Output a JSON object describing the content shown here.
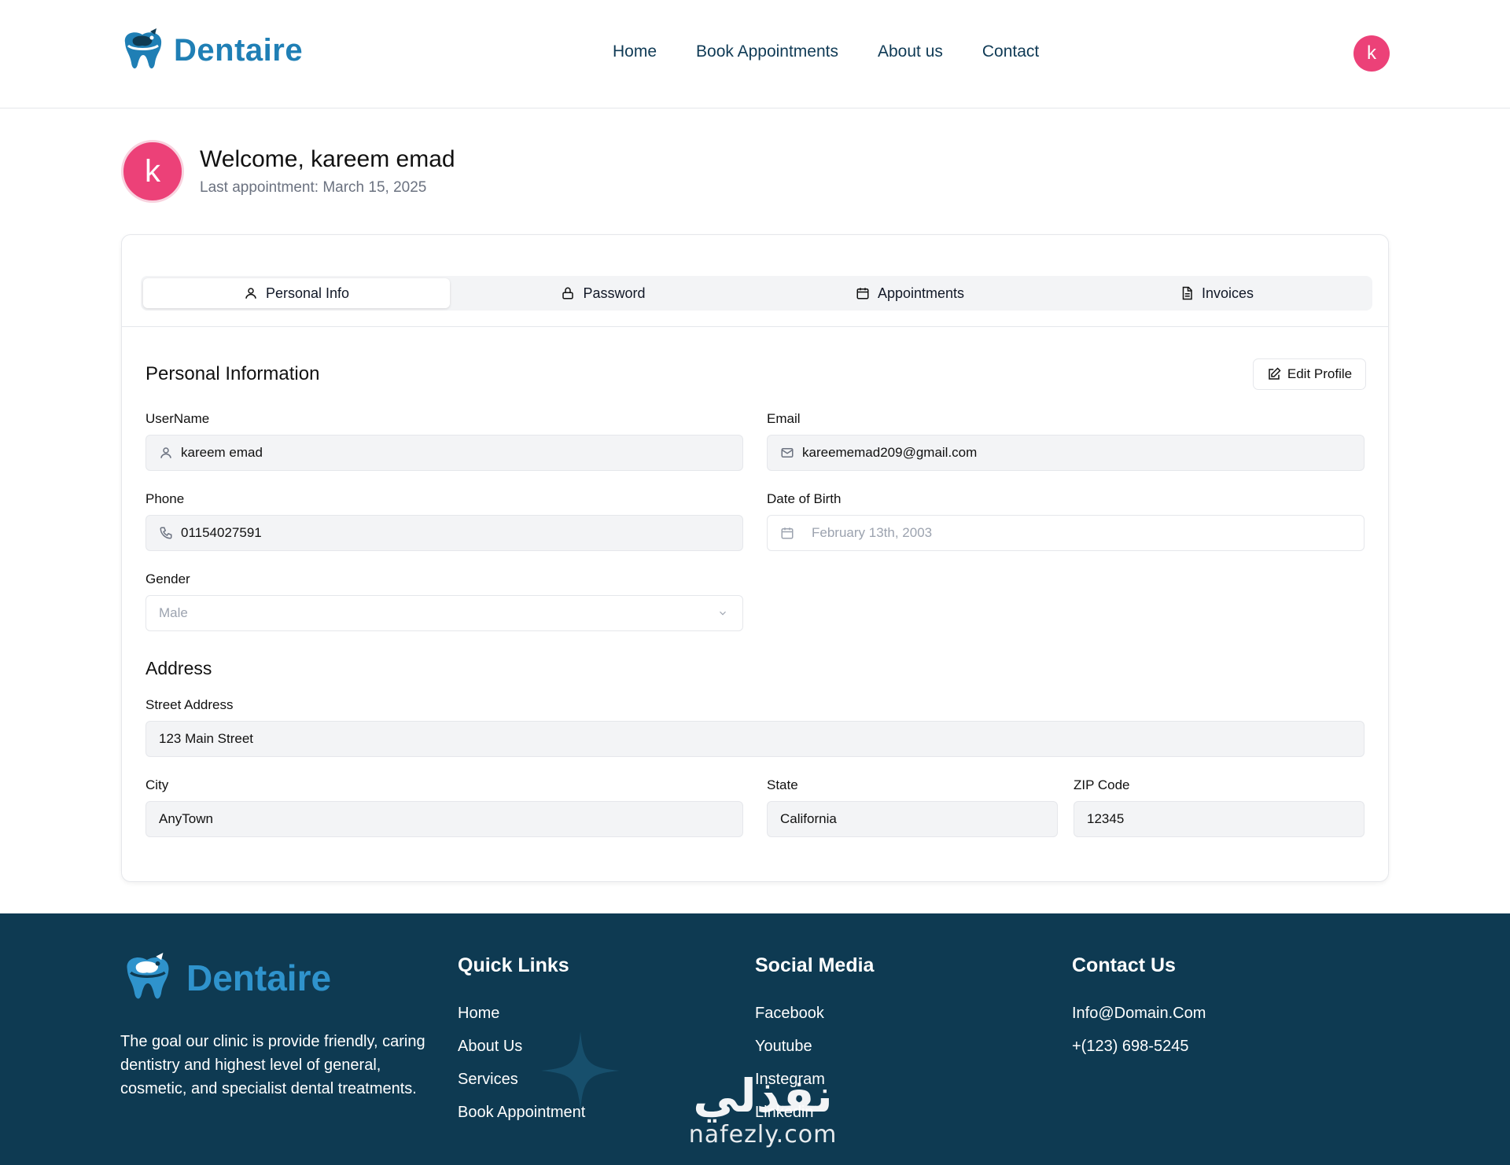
{
  "header": {
    "brand": "Dentaire",
    "nav": [
      "Home",
      "Book Appointments",
      "About us",
      "Contact"
    ],
    "avatar_letter": "k"
  },
  "welcome": {
    "avatar_letter": "k",
    "title": "Welcome, kareem emad",
    "subtitle": "Last appointment: March 15, 2025"
  },
  "tabs": [
    {
      "label": "Personal Info",
      "icon": "user-icon",
      "active": true
    },
    {
      "label": "Password",
      "icon": "lock-icon",
      "active": false
    },
    {
      "label": "Appointments",
      "icon": "calendar-icon",
      "active": false
    },
    {
      "label": "Invoices",
      "icon": "document-icon",
      "active": false
    }
  ],
  "personal": {
    "title": "Personal Information",
    "edit_label": "Edit Profile",
    "username_label": "UserName",
    "username_value": "kareem emad",
    "email_label": "Email",
    "email_value": "kareememad209@gmail.com",
    "phone_label": "Phone",
    "phone_value": "01154027591",
    "dob_label": "Date of Birth",
    "dob_value": "February 13th, 2003",
    "gender_label": "Gender",
    "gender_value": "Male"
  },
  "address": {
    "title": "Address",
    "street_label": "Street Address",
    "street_value": "123 Main Street",
    "city_label": "City",
    "city_value": "AnyTown",
    "state_label": "State",
    "state_value": "California",
    "zip_label": "ZIP Code",
    "zip_value": "12345"
  },
  "footer": {
    "brand": "Dentaire",
    "description": "The goal our clinic is provide friendly, caring dentistry and highest level of general, cosmetic, and specialist dental treatments.",
    "quick_links_title": "Quick Links",
    "quick_links": [
      "Home",
      "About Us",
      "Services",
      "Book Appointment"
    ],
    "social_title": "Social Media",
    "social": [
      "Facebook",
      "Youtube",
      "Instegram",
      "Linkedin"
    ],
    "contact_title": "Contact Us",
    "contact": [
      "Info@Domain.Com",
      "+(123) 698-5245"
    ]
  },
  "watermark": {
    "arabic": "نفذلي",
    "latin": "nafezly.com"
  },
  "colors": {
    "brand_blue": "#1f7fb5",
    "avatar_pink": "#ec4178",
    "footer_bg": "#0e3a52"
  }
}
